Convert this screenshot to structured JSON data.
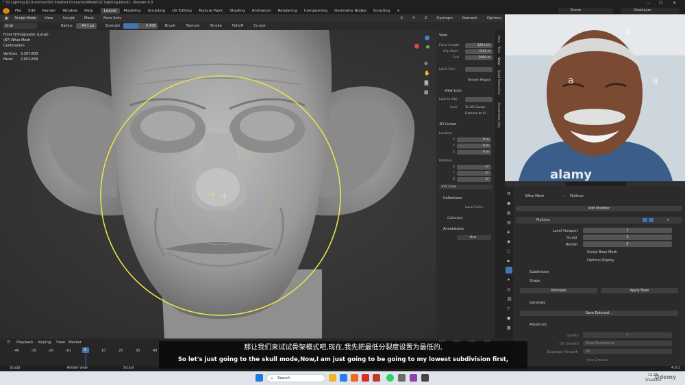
{
  "window": {
    "title": "* 32 Lighting [D:\\tutorials\\Old Stylized Character\\Model\\32 Lighting.blend] - Blender 4.0"
  },
  "menus": [
    "File",
    "Edit",
    "Render",
    "Window",
    "Help"
  ],
  "workspaces": [
    "Layout",
    "Modeling",
    "Sculpting",
    "UV Editing",
    "Texture Paint",
    "Shading",
    "Animation",
    "Rendering",
    "Compositing",
    "Geometry Nodes",
    "Scripting"
  ],
  "active_workspace": "Layout",
  "scene": {
    "label": "Scene",
    "view_layer": "ViewLayer"
  },
  "header": {
    "mode": "Sculpt Mode",
    "view": "View",
    "sculpt": "Sculpt",
    "mask": "Mask",
    "face_sets": "Face Sets",
    "dyntopo": "Dyntopo",
    "remesh": "Remesh",
    "options": "Options",
    "axes": [
      "X",
      "Y",
      "Z"
    ]
  },
  "tool_settings": {
    "brush": "Grab",
    "radius_label": "Radius",
    "radius_value": "44.1 px",
    "strength_label": "Strength",
    "strength_value": "0.436",
    "brush_menu": "Brush",
    "texture_menu": "Texture",
    "stroke_menu": "Stroke",
    "falloff_menu": "Falloff",
    "cursor_menu": "Cursor"
  },
  "overlay_info": {
    "view_name": "Front Orthographic (Local)",
    "object": "(87) BAse Mesh",
    "units": "Centimeters",
    "vertices_label": "Vertices",
    "vertices": "3,207,600",
    "faces_label": "Faces",
    "faces": "2,052,844"
  },
  "n_panel": {
    "view_header": "View",
    "focal_length_label": "Focal Length",
    "focal_length": "120 mm",
    "clip_start_label": "Clip Start",
    "clip_start": "0.01 m",
    "end_label": "End",
    "end": "1000 m",
    "local_camera_label": "Local Cam...",
    "render_region": "Render Region",
    "view_lock_header": "View Lock",
    "lock_to_object_label": "Lock to Obj...",
    "lock_label": "Lock",
    "to_3d_cursor": "To 3D Cursor",
    "camera_to_view": "Camera to Vi...",
    "cursor_header": "3D Cursor",
    "location_label": "Location",
    "rotation_label": "Rotation",
    "location": [
      {
        "axis": "X",
        "value": "0 m"
      },
      {
        "axis": "Y",
        "value": "0 m"
      },
      {
        "axis": "Z",
        "value": "0 m"
      }
    ],
    "rotation": [
      {
        "axis": "X",
        "value": "0°"
      },
      {
        "axis": "Y",
        "value": "0°"
      },
      {
        "axis": "Z",
        "value": "0°"
      }
    ],
    "rotation_mode": "XYZ Euler",
    "collections_header": "Collections",
    "local_collection": "Local Colle...",
    "collection": "Collection",
    "annotations_header": "Annotations",
    "annotations_new": "New"
  },
  "side_tabs": [
    "Item",
    "Tool",
    "View",
    "Quad Remesher",
    "Smoothtool_Key"
  ],
  "webcam": {
    "watermark": "alamy",
    "letters": [
      "a",
      "a",
      "a"
    ]
  },
  "properties": {
    "object_name": "BAse Mesh",
    "modifier_breadcrumb": "Multires",
    "add_modifier": "Add Modifier",
    "modifier_name": "Multires",
    "level_viewport_label": "Level Viewport",
    "level_viewport": "1",
    "sculpt_label": "Sculpt",
    "sculpt": "3",
    "render_label": "Render",
    "render": "5",
    "sculpt_base_mesh": "Sculpt Base Mesh",
    "optimal_display": "Optimal Display",
    "subdivision": "Subdivision",
    "shape": "Shape",
    "reshape": "Reshape",
    "apply_base": "Apply Base",
    "generate": "Generate",
    "save_external": "Save External...",
    "advanced": "Advanced",
    "quality_label": "Quality",
    "quality": "4",
    "uv_smooth_label": "UV Smooth",
    "uv_smooth": "Keep Boundaries",
    "boundary_smooth_label": "Boundary Smooth",
    "boundary_smooth": "All",
    "use_creases": "Use Creases"
  },
  "timeline": {
    "playback": "Playback",
    "keying": "Keying",
    "view": "View",
    "marker": "Marker",
    "frames": [
      "-40",
      "-30",
      "-20",
      "-10",
      "0",
      "10",
      "20",
      "30",
      "40"
    ],
    "right_frames": [
      "220",
      "230",
      "240",
      "250"
    ]
  },
  "statusbar": {
    "left": "Sculpt",
    "rotate": "Rotate View",
    "right": "Sculpt",
    "version": "4.0.1"
  },
  "subtitles": {
    "zh": "那让我们来试试骨架模式吧,现在,我先把最低分裂度设置为最低的,",
    "en": "So let's just going to the skull mode,Now,I am just going to be going to my lowest subdivision first,"
  },
  "taskbar": {
    "search": "Search",
    "time": "12:28",
    "date": "5/14/2024"
  },
  "watermark": "Udemy",
  "colors": {
    "brush_circle": "#e8e24a",
    "accent": "#4772b3",
    "header": "#303030"
  }
}
